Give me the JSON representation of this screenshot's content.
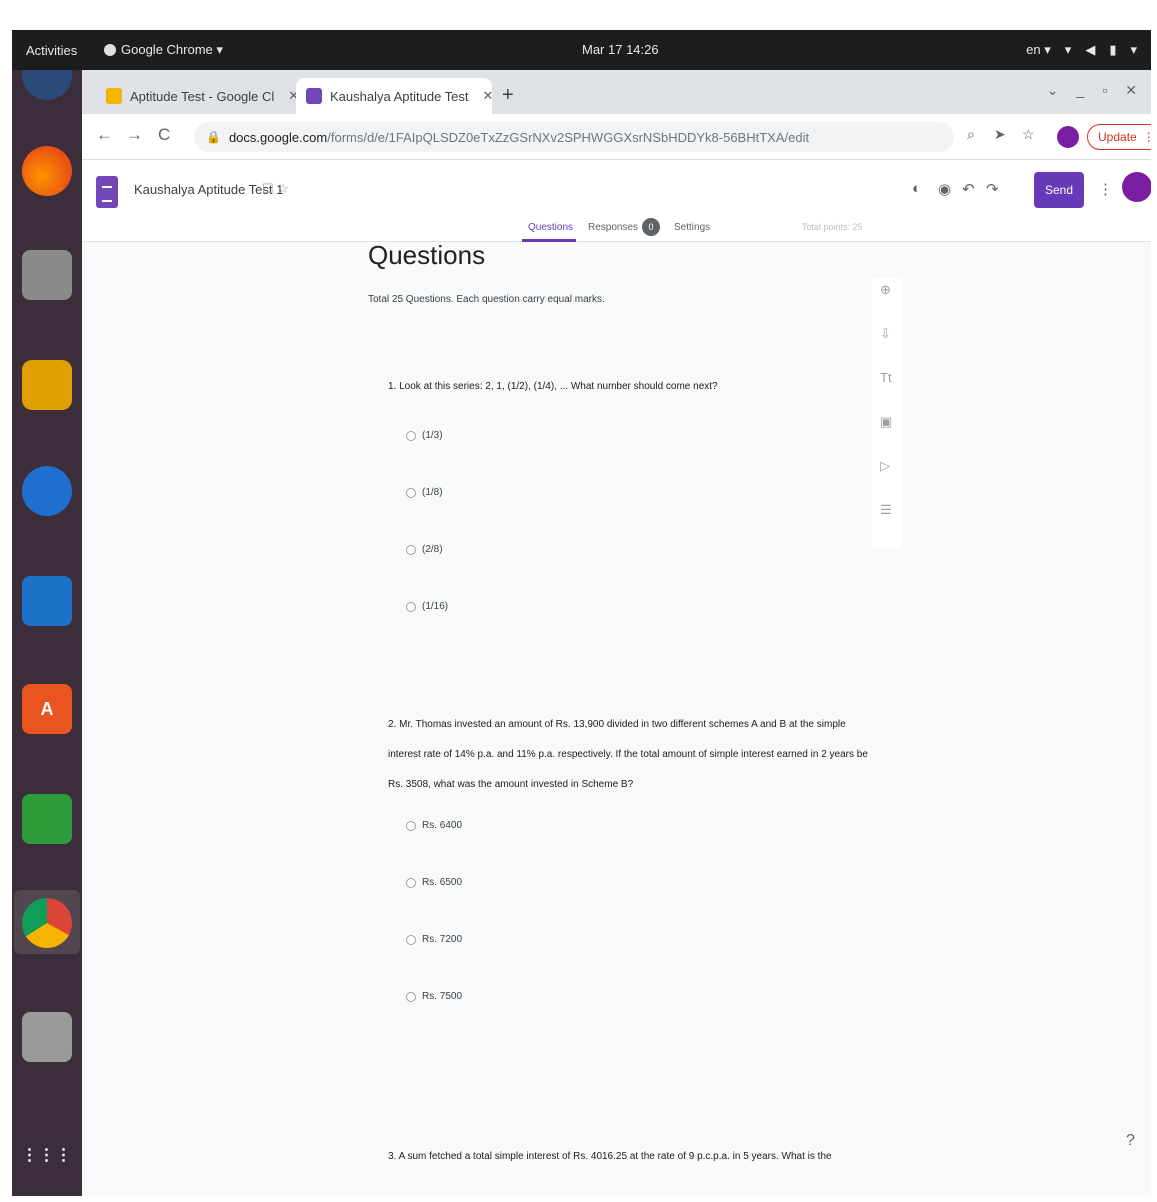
{
  "system": {
    "activities": "Activities",
    "app_menu": "Google Chrome ▾",
    "clock": "Mar 17 14:26",
    "language": "en ▾"
  },
  "browser": {
    "tabs": [
      {
        "label": "Aptitude Test - Google Cl",
        "active": false
      },
      {
        "label": "Kaushalya Aptitude Test",
        "active": true
      }
    ],
    "url": "docs.google.com",
    "url_path": "/forms/d/e/1FAIpQLSDZ0eTxZzGSrNXv2SPHWGGXsrNSbHDDYk8-56BHtTXA/edit",
    "update_label": "Update"
  },
  "form": {
    "title": "Kaushalya Aptitude Test 1",
    "send_label": "Send",
    "tabs": {
      "questions": "Questions",
      "responses": "Responses",
      "settings": "Settings"
    },
    "response_count": "0",
    "total_points": "Total points: 25",
    "section_title": "Questions",
    "section_desc": "Total 25 Questions. Each question carry equal marks.",
    "questions": [
      {
        "text": "1. Look at this series: 2, 1, (1/2), (1/4), ... What number should come next?",
        "options": [
          "(1/3)",
          "(1/8)",
          "(2/8)",
          "(1/16)"
        ]
      },
      {
        "text": "2. Mr. Thomas invested an amount of Rs. 13,900 divided in two different schemes A and B at the simple interest rate of 14% p.a. and 11% p.a. respectively. If the total amount of simple interest earned in 2 years be Rs. 3508, what was the amount invested in Scheme B?",
        "options": [
          "Rs. 6400",
          "Rs. 6500",
          "Rs. 7200",
          "Rs. 7500"
        ]
      },
      {
        "text": "3. A sum fetched a total simple interest of Rs. 4016.25 at the rate of 9 p.c.p.a. in 5 years. What is the"
      }
    ]
  }
}
